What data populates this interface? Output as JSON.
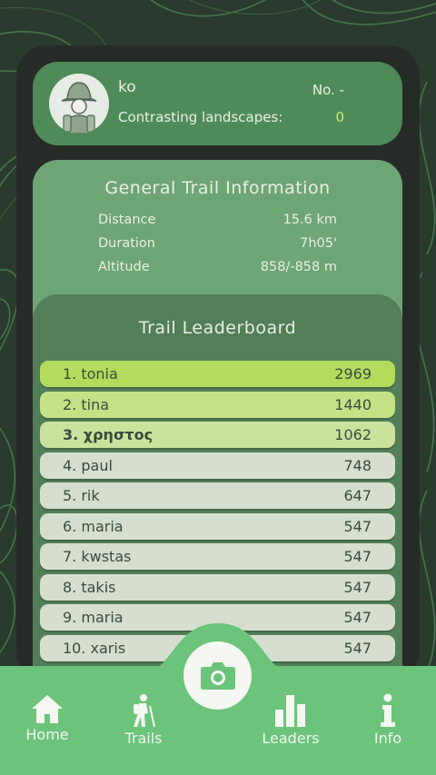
{
  "profile": {
    "username": "ko",
    "rank": "No. -",
    "contrasting_label": "Contrasting landscapes:",
    "contrasting_value": "0"
  },
  "trail_info": {
    "title": "General Trail Information",
    "rows": [
      {
        "label": "Distance",
        "value": "15.6 km"
      },
      {
        "label": "Duration",
        "value": "7h05'"
      },
      {
        "label": "Altitude",
        "value": "858/-858 m"
      }
    ]
  },
  "leaderboard": {
    "title": "Trail Leaderboard",
    "entries": [
      {
        "name": "1. tonia",
        "score": "2969"
      },
      {
        "name": "2. tina",
        "score": "1440"
      },
      {
        "name": "3. χρηστος",
        "score": "1062"
      },
      {
        "name": "4. paul",
        "score": "748"
      },
      {
        "name": "5. rik",
        "score": "647"
      },
      {
        "name": "6. maria",
        "score": "547"
      },
      {
        "name": "7. kwstas",
        "score": "547"
      },
      {
        "name": "8. takis",
        "score": "547"
      },
      {
        "name": "9. maria",
        "score": "547"
      },
      {
        "name": "10. xaris",
        "score": "547"
      }
    ]
  },
  "nav": {
    "home": "Home",
    "trails": "Trails",
    "leaders": "Leaders",
    "info": "Info"
  },
  "icons": {
    "camera": "camera-icon",
    "home": "home-icon",
    "trails": "hiker-icon",
    "leaders": "bar-chart-icon",
    "info": "info-icon"
  },
  "colors": {
    "nav_bg": "#6bc47a",
    "first_place": "#b3dc5c",
    "second_place": "#c3e286",
    "third_place": "#cbe29d",
    "other_places": "#d6decf",
    "accent_value": "#c8e67a"
  }
}
